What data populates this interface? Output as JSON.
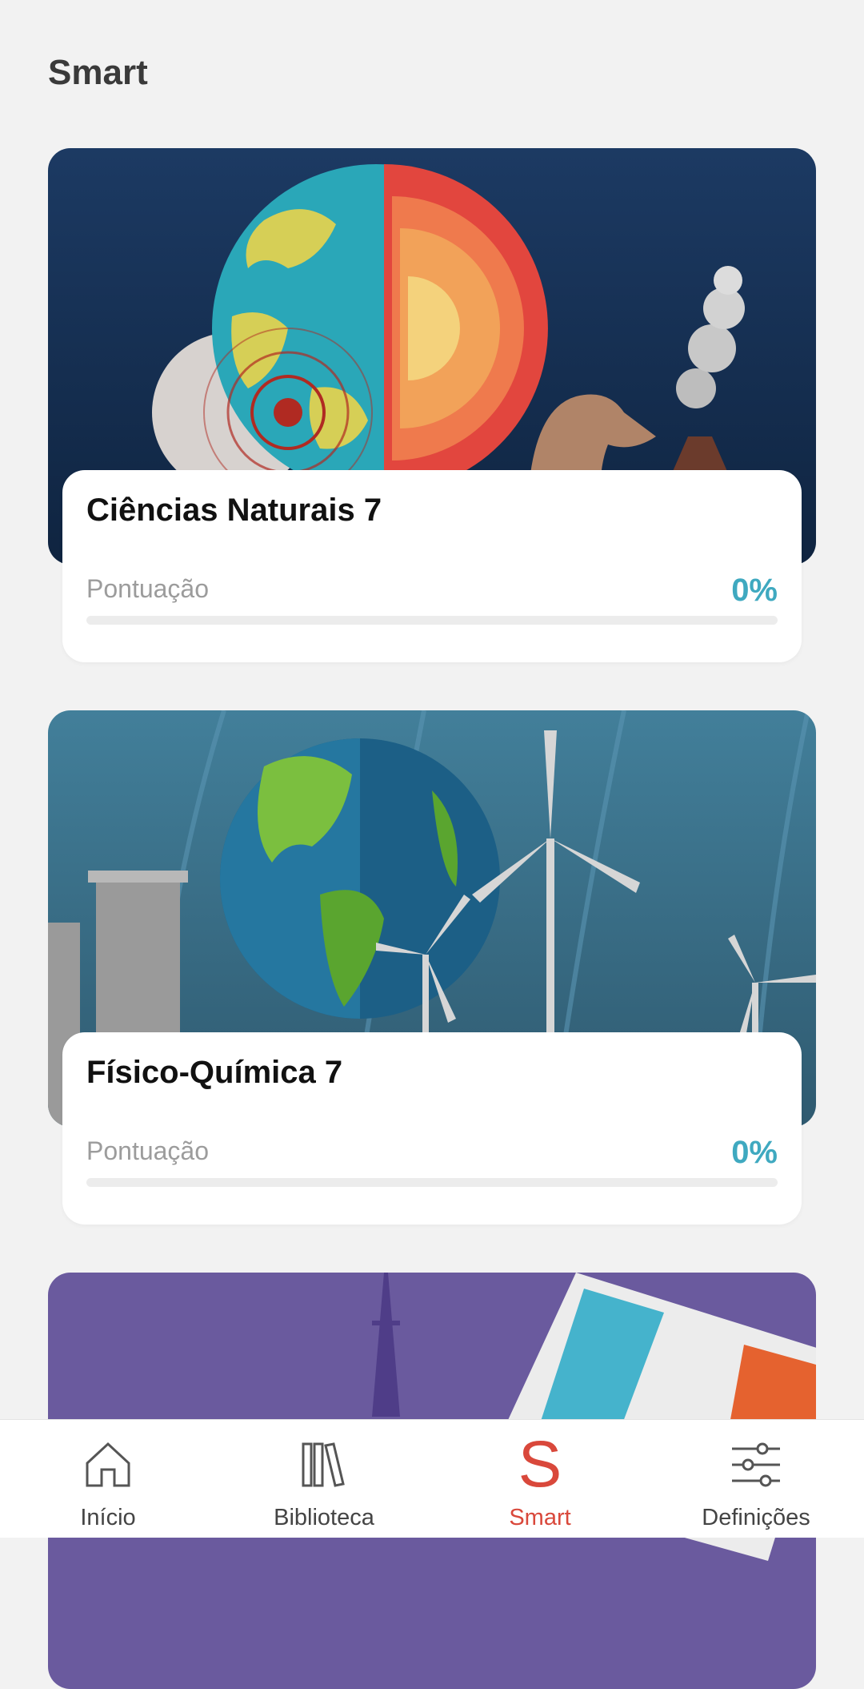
{
  "page": {
    "title": "Smart"
  },
  "courses": [
    {
      "title": "Ciências Naturais 7",
      "score_label": "Pontuação",
      "score_value": "0%",
      "progress_fraction": 0
    },
    {
      "title": "Físico-Química 7",
      "score_label": "Pontuação",
      "score_value": "0%",
      "progress_fraction": 0
    },
    {
      "title": "",
      "score_label": "",
      "score_value": "",
      "progress_fraction": 0
    }
  ],
  "nav": {
    "items": [
      {
        "label": "Início",
        "icon": "home-icon",
        "active": false
      },
      {
        "label": "Biblioteca",
        "icon": "library-icon",
        "active": false
      },
      {
        "label": "Smart",
        "icon": "smart-s-icon",
        "active": true
      },
      {
        "label": "Definições",
        "icon": "settings-sliders-icon",
        "active": false
      }
    ]
  },
  "colors": {
    "background": "#f2f2f2",
    "accent_progress": "#3fa9c0",
    "active_nav": "#d9483b",
    "card1_sky": "#1c3a63",
    "card2_sky": "#3e7a96",
    "card3_sky": "#6a5a9e"
  }
}
